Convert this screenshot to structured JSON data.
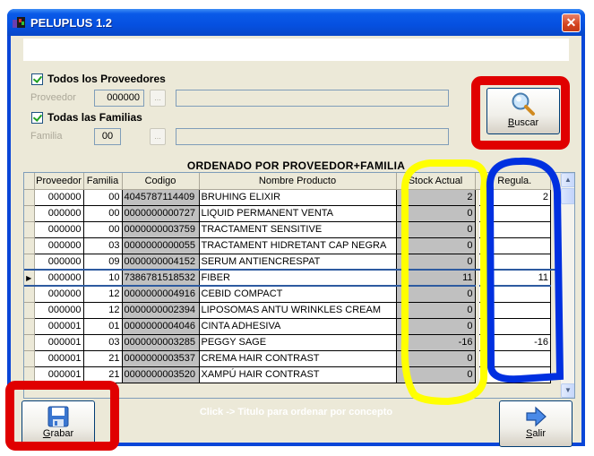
{
  "window": {
    "title": "PELUPLUS 1.2",
    "close_symbol": "✕"
  },
  "message_bar": "",
  "filters": {
    "all_suppliers_label": "Todos los Proveedores",
    "all_suppliers_checked": true,
    "supplier_label": "Proveedor",
    "supplier_code": "000000",
    "supplier_browse": "...",
    "supplier_name": "",
    "all_families_label": "Todas las Familias",
    "all_families_checked": true,
    "family_label": "Familia",
    "family_code": "00",
    "family_browse": "...",
    "family_name": ""
  },
  "buttons": {
    "search": "Buscar",
    "search_icon": "magnifier-icon",
    "save": "Grabar",
    "save_icon": "floppy-disk-icon",
    "exit": "Salir",
    "exit_icon": "right-arrow-icon"
  },
  "sort_title": "ORDENADO POR PROVEEDOR+FAMILIA",
  "grid": {
    "columns": [
      "Proveedor",
      "Familia",
      "Codigo",
      "Nombre Producto",
      "Stock Actual",
      "Regula."
    ],
    "selected_row_index": 5,
    "rows": [
      {
        "proveedor": "000000",
        "familia": "00",
        "codigo": "4045787114409",
        "nombre": "BRUHING ELIXIR",
        "stock": "2",
        "regula": "2"
      },
      {
        "proveedor": "000000",
        "familia": "00",
        "codigo": "0000000000727",
        "nombre": "LIQUID PERMANENT VENTA",
        "stock": "0",
        "regula": ""
      },
      {
        "proveedor": "000000",
        "familia": "00",
        "codigo": "0000000003759",
        "nombre": "TRACTAMENT SENSITIVE",
        "stock": "0",
        "regula": ""
      },
      {
        "proveedor": "000000",
        "familia": "03",
        "codigo": "0000000000055",
        "nombre": "TRACTAMENT HIDRETANT CAP NEGRA",
        "stock": "0",
        "regula": ""
      },
      {
        "proveedor": "000000",
        "familia": "09",
        "codigo": "0000000004152",
        "nombre": "SERUM ANTIENCRESPAT",
        "stock": "0",
        "regula": ""
      },
      {
        "proveedor": "000000",
        "familia": "10",
        "codigo": "7386781518532",
        "nombre": "FIBER",
        "stock": "11",
        "regula": "11"
      },
      {
        "proveedor": "000000",
        "familia": "12",
        "codigo": "0000000004916",
        "nombre": "CEBID COMPACT",
        "stock": "0",
        "regula": ""
      },
      {
        "proveedor": "000000",
        "familia": "12",
        "codigo": "0000000002394",
        "nombre": "LIPOSOMAS ANTU WRINKLES CREAM",
        "stock": "0",
        "regula": ""
      },
      {
        "proveedor": "000001",
        "familia": "01",
        "codigo": "0000000004046",
        "nombre": "CINTA ADHESIVA",
        "stock": "0",
        "regula": ""
      },
      {
        "proveedor": "000001",
        "familia": "03",
        "codigo": "0000000003285",
        "nombre": "PEGGY SAGE",
        "stock": "-16",
        "regula": "-16"
      },
      {
        "proveedor": "000001",
        "familia": "21",
        "codigo": "0000000003537",
        "nombre": "CREMA HAIR CONTRAST",
        "stock": "0",
        "regula": ""
      },
      {
        "proveedor": "000001",
        "familia": "21",
        "codigo": "0000000003520",
        "nombre": "XAMPÚ HAIR CONTRAST",
        "stock": "0",
        "regula": ""
      }
    ]
  },
  "hint": "Click -> Titulo para ordenar por concepto",
  "annotations": {
    "search_highlight_color": "#e00000",
    "save_highlight_color": "#e00000",
    "stock_highlight_color": "#ffff00",
    "regula_highlight_color": "#0030e0"
  }
}
